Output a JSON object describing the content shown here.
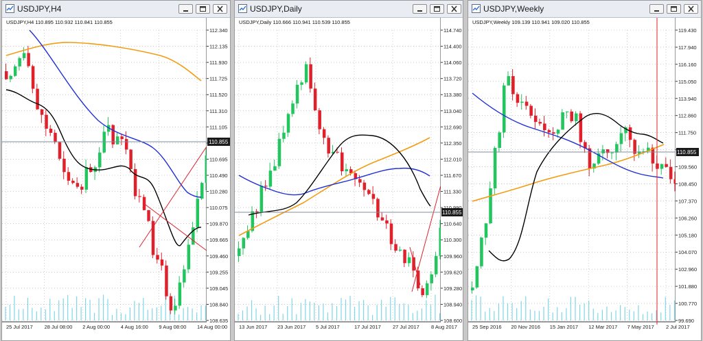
{
  "colors": {
    "bull": "#22c55e",
    "bear": "#e0202a",
    "sma_slow": "#f39c12",
    "sma_mid": "#1f2fd6",
    "sma_fast": "#000000",
    "volume": "#7fd6e8",
    "grid": "#a9a9a9",
    "close_line": "#7f8d9c"
  },
  "windows": [
    {
      "title": "USDJPY,H4",
      "info": "USDJPY,H4  110.895 110.932 110.841 110.855",
      "price_tag": "110.855",
      "yticks": [
        "112.340",
        "112.135",
        "111.930",
        "111.725",
        "111.520",
        "111.310",
        "111.105",
        "110.900",
        "110.695",
        "110.490",
        "110.280",
        "110.075",
        "109.870",
        "109.665",
        "109.460",
        "109.255",
        "109.045",
        "108.840",
        "108.635"
      ],
      "xticks": [
        "25 Jul 2017",
        "28 Jul 08:00",
        "2 Aug 00:00",
        "4 Aug 16:00",
        "9 Aug 08:00",
        "14 Aug 00:00"
      ],
      "icons": [
        "window-icon",
        "minimize-icon",
        "restore-icon",
        "close-icon"
      ]
    },
    {
      "title": "USDJPY,Daily",
      "info": "USDJPY,Daily  110.666 110.941 110.539 110.855",
      "price_tag": "110.855",
      "yticks": [
        "114.740",
        "114.400",
        "114.060",
        "113.720",
        "113.380",
        "113.040",
        "112.690",
        "112.350",
        "112.010",
        "111.670",
        "111.330",
        "110.990",
        "110.640",
        "110.300",
        "109.960",
        "109.620",
        "109.280",
        "108.940",
        "108.600"
      ],
      "xticks": [
        "13 Jun 2017",
        "23 Jun 2017",
        "5 Jul 2017",
        "17 Jul 2017",
        "27 Jul 2017",
        "8 Aug 2017"
      ],
      "icons": [
        "window-icon",
        "minimize-icon",
        "restore-icon",
        "close-icon"
      ]
    },
    {
      "title": "USDJPY,Weekly",
      "info": "USDJPY,Weekly  109.139 110.941 109.020 110.855",
      "price_tag": "110.855",
      "yticks": [
        "119.430",
        "117.940",
        "116.160",
        "115.050",
        "113.940",
        "112.860",
        "111.750",
        "110.670",
        "109.560",
        "108.450",
        "107.370",
        "106.260",
        "105.180",
        "104.070",
        "102.960",
        "101.880",
        "100.770",
        "99.690"
      ],
      "xticks": [
        "25 Sep 2016",
        "20 Nov 2016",
        "15 Jan 2017",
        "12 Mar 2017",
        "7 May 2017",
        "2 Jul 2017"
      ],
      "icons": [
        "window-icon",
        "minimize-icon",
        "restore-icon",
        "close-icon"
      ]
    }
  ]
}
